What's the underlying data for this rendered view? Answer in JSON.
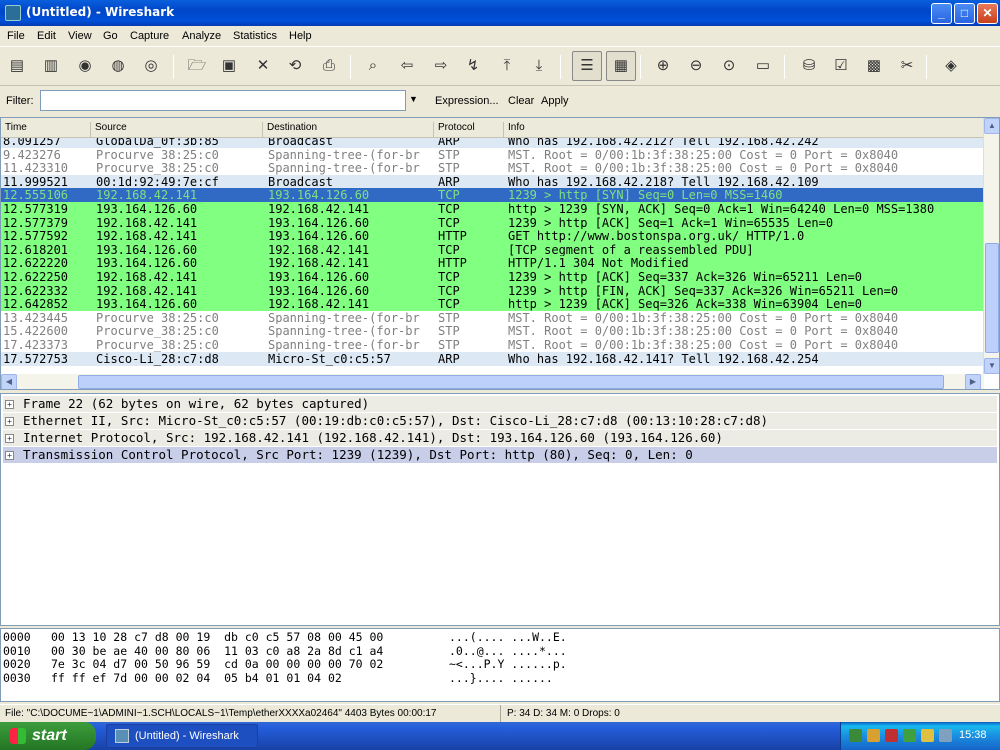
{
  "window": {
    "title": "(Untitled) - Wireshark",
    "buttons": [
      "_",
      "□",
      "✕"
    ]
  },
  "menu": [
    "File",
    "Edit",
    "View",
    "Go",
    "Capture",
    "Analyze",
    "Statistics",
    "Help"
  ],
  "toolbar": [
    {
      "name": "interfaces-icon",
      "glyph": "▤"
    },
    {
      "name": "capture-options-icon",
      "glyph": "▥"
    },
    {
      "name": "start-capture-icon",
      "glyph": "◉"
    },
    {
      "name": "stop-capture-icon",
      "glyph": "◍"
    },
    {
      "name": "restart-capture-icon",
      "glyph": "◎"
    },
    {
      "name": "open-file-icon",
      "glyph": "🗁"
    },
    {
      "name": "save-file-icon",
      "glyph": "▣"
    },
    {
      "name": "close-file-icon",
      "glyph": "✕"
    },
    {
      "name": "reload-icon",
      "glyph": "⟲"
    },
    {
      "name": "print-icon",
      "glyph": "⎙"
    },
    {
      "name": "find-packet-icon",
      "glyph": "⌕"
    },
    {
      "name": "go-back-icon",
      "glyph": "⇦"
    },
    {
      "name": "go-forward-icon",
      "glyph": "⇨"
    },
    {
      "name": "go-to-packet-icon",
      "glyph": "↯"
    },
    {
      "name": "first-packet-icon",
      "glyph": "⤒"
    },
    {
      "name": "last-packet-icon",
      "glyph": "⤓"
    },
    {
      "name": "colorize-icon",
      "glyph": "☰",
      "pressed": true
    },
    {
      "name": "auto-scroll-icon",
      "glyph": "▦",
      "pressed": true
    },
    {
      "name": "zoom-in-icon",
      "glyph": "⊕"
    },
    {
      "name": "zoom-out-icon",
      "glyph": "⊖"
    },
    {
      "name": "normal-size-icon",
      "glyph": "⊙"
    },
    {
      "name": "resize-columns-icon",
      "glyph": "▭"
    },
    {
      "name": "capture-filters-icon",
      "glyph": "⛁"
    },
    {
      "name": "display-filters-icon",
      "glyph": "☑"
    },
    {
      "name": "coloring-rules-icon",
      "glyph": "▩"
    },
    {
      "name": "preferences-icon",
      "glyph": "✂"
    },
    {
      "name": "help-icon",
      "glyph": "◈"
    }
  ],
  "filter": {
    "label": "Filter:",
    "value": "",
    "expression": "Expression...",
    "clear": "Clear",
    "apply": "Apply"
  },
  "packet_list": {
    "columns": [
      "Time",
      "Source",
      "Destination",
      "Protocol",
      "Info"
    ],
    "rows": [
      {
        "time": "8.091257",
        "source": "GlobalDa_0f:3b:85",
        "destination": "Broadcast",
        "protocol": "ARP",
        "info": "Who has 192.168.42.212?  Tell 192.168.42.242",
        "bg": "#dce8f4",
        "fg": "#000000"
      },
      {
        "time": "9.423276",
        "source": "Procurve_38:25:c0",
        "destination": "Spanning-tree-(for-br",
        "protocol": "STP",
        "info": "MST. Root = 0/00:1b:3f:38:25:00  Cost = 0  Port = 0x8040",
        "bg": "#ffffff",
        "fg": "#808080"
      },
      {
        "time": "11.423310",
        "source": "Procurve_38:25:c0",
        "destination": "Spanning-tree-(for-br",
        "protocol": "STP",
        "info": "MST. Root = 0/00:1b:3f:38:25:00  Cost = 0  Port = 0x8040",
        "bg": "#ffffff",
        "fg": "#808080"
      },
      {
        "time": "11.999521",
        "source": "00:1d:92:49:7e:cf",
        "destination": "Broadcast",
        "protocol": "ARP",
        "info": "Who has 192.168.42.218?  Tell 192.168.42.109",
        "bg": "#dce8f4",
        "fg": "#000000"
      },
      {
        "time": "12.555106",
        "source": "192.168.42.141",
        "destination": "193.164.126.60",
        "protocol": "TCP",
        "info": "1239 > http [SYN] Seq=0 Len=0 MSS=1460",
        "bg": "#316ac5",
        "fg": "#7fe080"
      },
      {
        "time": "12.577319",
        "source": "193.164.126.60",
        "destination": "192.168.42.141",
        "protocol": "TCP",
        "info": "http > 1239 [SYN, ACK] Seq=0 Ack=1 Win=64240 Len=0 MSS=1380",
        "bg": "#80ff80",
        "fg": "#000000"
      },
      {
        "time": "12.577379",
        "source": "192.168.42.141",
        "destination": "193.164.126.60",
        "protocol": "TCP",
        "info": "1239 > http [ACK] Seq=1 Ack=1 Win=65535 Len=0",
        "bg": "#80ff80",
        "fg": "#000000"
      },
      {
        "time": "12.577592",
        "source": "192.168.42.141",
        "destination": "193.164.126.60",
        "protocol": "HTTP",
        "info": "GET http://www.bostonspa.org.uk/ HTTP/1.0",
        "bg": "#80ff80",
        "fg": "#000000"
      },
      {
        "time": "12.618201",
        "source": "193.164.126.60",
        "destination": "192.168.42.141",
        "protocol": "TCP",
        "info": "[TCP segment of a reassembled PDU]",
        "bg": "#80ff80",
        "fg": "#000000"
      },
      {
        "time": "12.622220",
        "source": "193.164.126.60",
        "destination": "192.168.42.141",
        "protocol": "HTTP",
        "info": "HTTP/1.1 304 Not Modified",
        "bg": "#80ff80",
        "fg": "#000000"
      },
      {
        "time": "12.622250",
        "source": "192.168.42.141",
        "destination": "193.164.126.60",
        "protocol": "TCP",
        "info": "1239 > http [ACK] Seq=337 Ack=326 Win=65211 Len=0",
        "bg": "#80ff80",
        "fg": "#000000"
      },
      {
        "time": "12.622332",
        "source": "192.168.42.141",
        "destination": "193.164.126.60",
        "protocol": "TCP",
        "info": "1239 > http [FIN, ACK] Seq=337 Ack=326 Win=65211 Len=0",
        "bg": "#80ff80",
        "fg": "#000000"
      },
      {
        "time": "12.642852",
        "source": "193.164.126.60",
        "destination": "192.168.42.141",
        "protocol": "TCP",
        "info": "http > 1239 [ACK] Seq=326 Ack=338 Win=63904 Len=0",
        "bg": "#80ff80",
        "fg": "#000000"
      },
      {
        "time": "13.423445",
        "source": "Procurve_38:25:c0",
        "destination": "Spanning-tree-(for-br",
        "protocol": "STP",
        "info": "MST. Root = 0/00:1b:3f:38:25:00  Cost = 0  Port = 0x8040",
        "bg": "#ffffff",
        "fg": "#808080"
      },
      {
        "time": "15.422600",
        "source": "Procurve_38:25:c0",
        "destination": "Spanning-tree-(for-br",
        "protocol": "STP",
        "info": "MST. Root = 0/00:1b:3f:38:25:00  Cost = 0  Port = 0x8040",
        "bg": "#ffffff",
        "fg": "#808080"
      },
      {
        "time": "17.423373",
        "source": "Procurve_38:25:c0",
        "destination": "Spanning-tree-(for-br",
        "protocol": "STP",
        "info": "MST. Root = 0/00:1b:3f:38:25:00  Cost = 0  Port = 0x8040",
        "bg": "#ffffff",
        "fg": "#808080"
      },
      {
        "time": "17.572753",
        "source": "Cisco-Li_28:c7:d8",
        "destination": "Micro-St_c0:c5:57",
        "protocol": "ARP",
        "info": "Who has 192.168.42.141?  Tell 192.168.42.254",
        "bg": "#dce8f4",
        "fg": "#000000"
      }
    ]
  },
  "details": [
    {
      "text": "Frame 22 (62 bytes on wire, 62 bytes captured)",
      "selected": false
    },
    {
      "text": "Ethernet II, Src: Micro-St_c0:c5:57 (00:19:db:c0:c5:57), Dst: Cisco-Li_28:c7:d8 (00:13:10:28:c7:d8)",
      "selected": false
    },
    {
      "text": "Internet Protocol, Src: 192.168.42.141 (192.168.42.141), Dst: 193.164.126.60 (193.164.126.60)",
      "selected": false
    },
    {
      "text": "Transmission Control Protocol, Src Port: 1239 (1239), Dst Port: http (80), Seq: 0, Len: 0",
      "selected": true
    }
  ],
  "hex": [
    {
      "offset": "0000",
      "bytes": "00 13 10 28 c7 d8 00 19  db c0 c5 57 08 00 45 00",
      "ascii": "...(.... ...W..E."
    },
    {
      "offset": "0010",
      "bytes": "00 30 be ae 40 00 80 06  11 03 c0 a8 2a 8d c1 a4",
      "ascii": ".0..@... ....*..."
    },
    {
      "offset": "0020",
      "bytes": "7e 3c 04 d7 00 50 96 59  cd 0a 00 00 00 00 70 02",
      "ascii": "~<...P.Y ......p."
    },
    {
      "offset": "0030",
      "bytes": "ff ff ef 7d 00 00 02 04  05 b4 01 01 04 02",
      "ascii": "...}.... ......"
    }
  ],
  "status": {
    "file": "File: \"C:\\DOCUME~1\\ADMINI~1.SCH\\LOCALS~1\\Temp\\etherXXXXa02464\" 4403 Bytes 00:00:17",
    "counts": "P: 34 D: 34 M: 0 Drops: 0"
  },
  "taskbar": {
    "start": "start",
    "task": "(Untitled) - Wireshark",
    "clock": "15:38"
  }
}
